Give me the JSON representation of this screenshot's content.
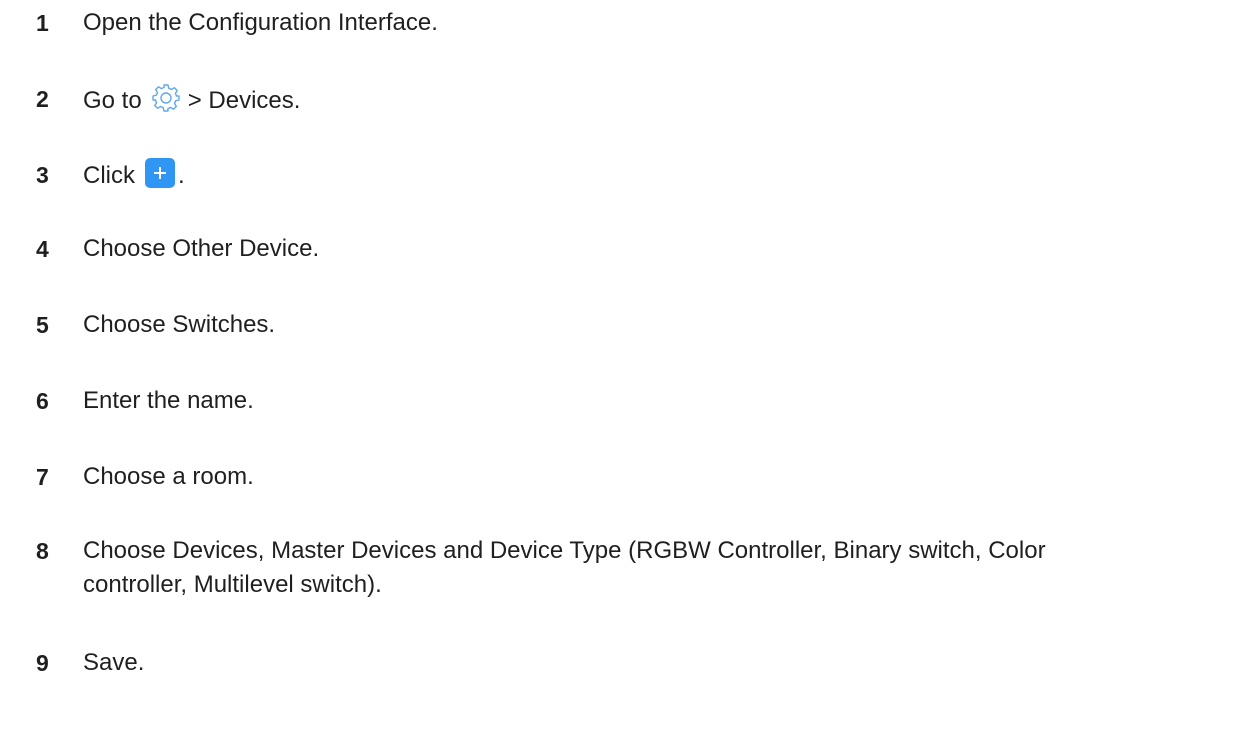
{
  "steps": [
    {
      "number": "1",
      "text": "Open the Configuration Interface."
    },
    {
      "number": "2",
      "text_before": "Go to",
      "icon": "gear-icon",
      "text_after": "> Devices."
    },
    {
      "number": "3",
      "text_before": "Click",
      "icon": "plus-button",
      "text_after": "."
    },
    {
      "number": "4",
      "text": "Choose Other Device."
    },
    {
      "number": "5",
      "text": "Choose Switches."
    },
    {
      "number": "6",
      "text": "Enter the name."
    },
    {
      "number": "7",
      "text": "Choose a room."
    },
    {
      "number": "8",
      "line1": "Choose Devices, Master Devices and Device Type (RGBW Controller, Binary switch, Color",
      "line2": "controller, Multilevel switch)."
    },
    {
      "number": "9",
      "text": "Save."
    }
  ],
  "colors": {
    "plus_button_bg": "#2f96f3",
    "gear_stroke": "#5fa8ee",
    "text": "#1f1f1f"
  }
}
